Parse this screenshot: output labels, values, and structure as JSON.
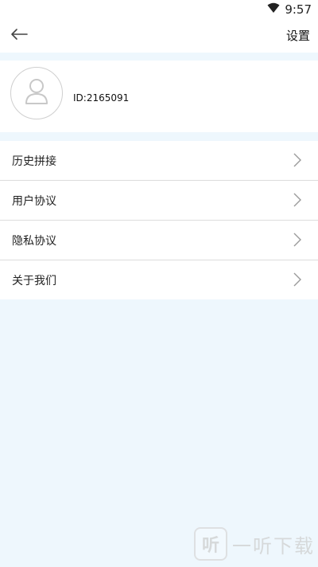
{
  "status_bar": {
    "time": "9:57",
    "wifi_icon": "wifi-icon"
  },
  "header": {
    "title": "设置",
    "back_icon": "arrow-left-icon"
  },
  "profile": {
    "id_text": "ID:2165091",
    "avatar_icon": "user-avatar-icon"
  },
  "menu": {
    "items": [
      {
        "label": "历史拼接"
      },
      {
        "label": "用户协议"
      },
      {
        "label": "隐私协议"
      },
      {
        "label": "关于我们"
      }
    ]
  },
  "watermark": {
    "logo_char": "听",
    "text": "一听下载"
  },
  "colors": {
    "background": "#eef7fd",
    "card": "#ffffff",
    "divider": "#dcdcdc"
  }
}
